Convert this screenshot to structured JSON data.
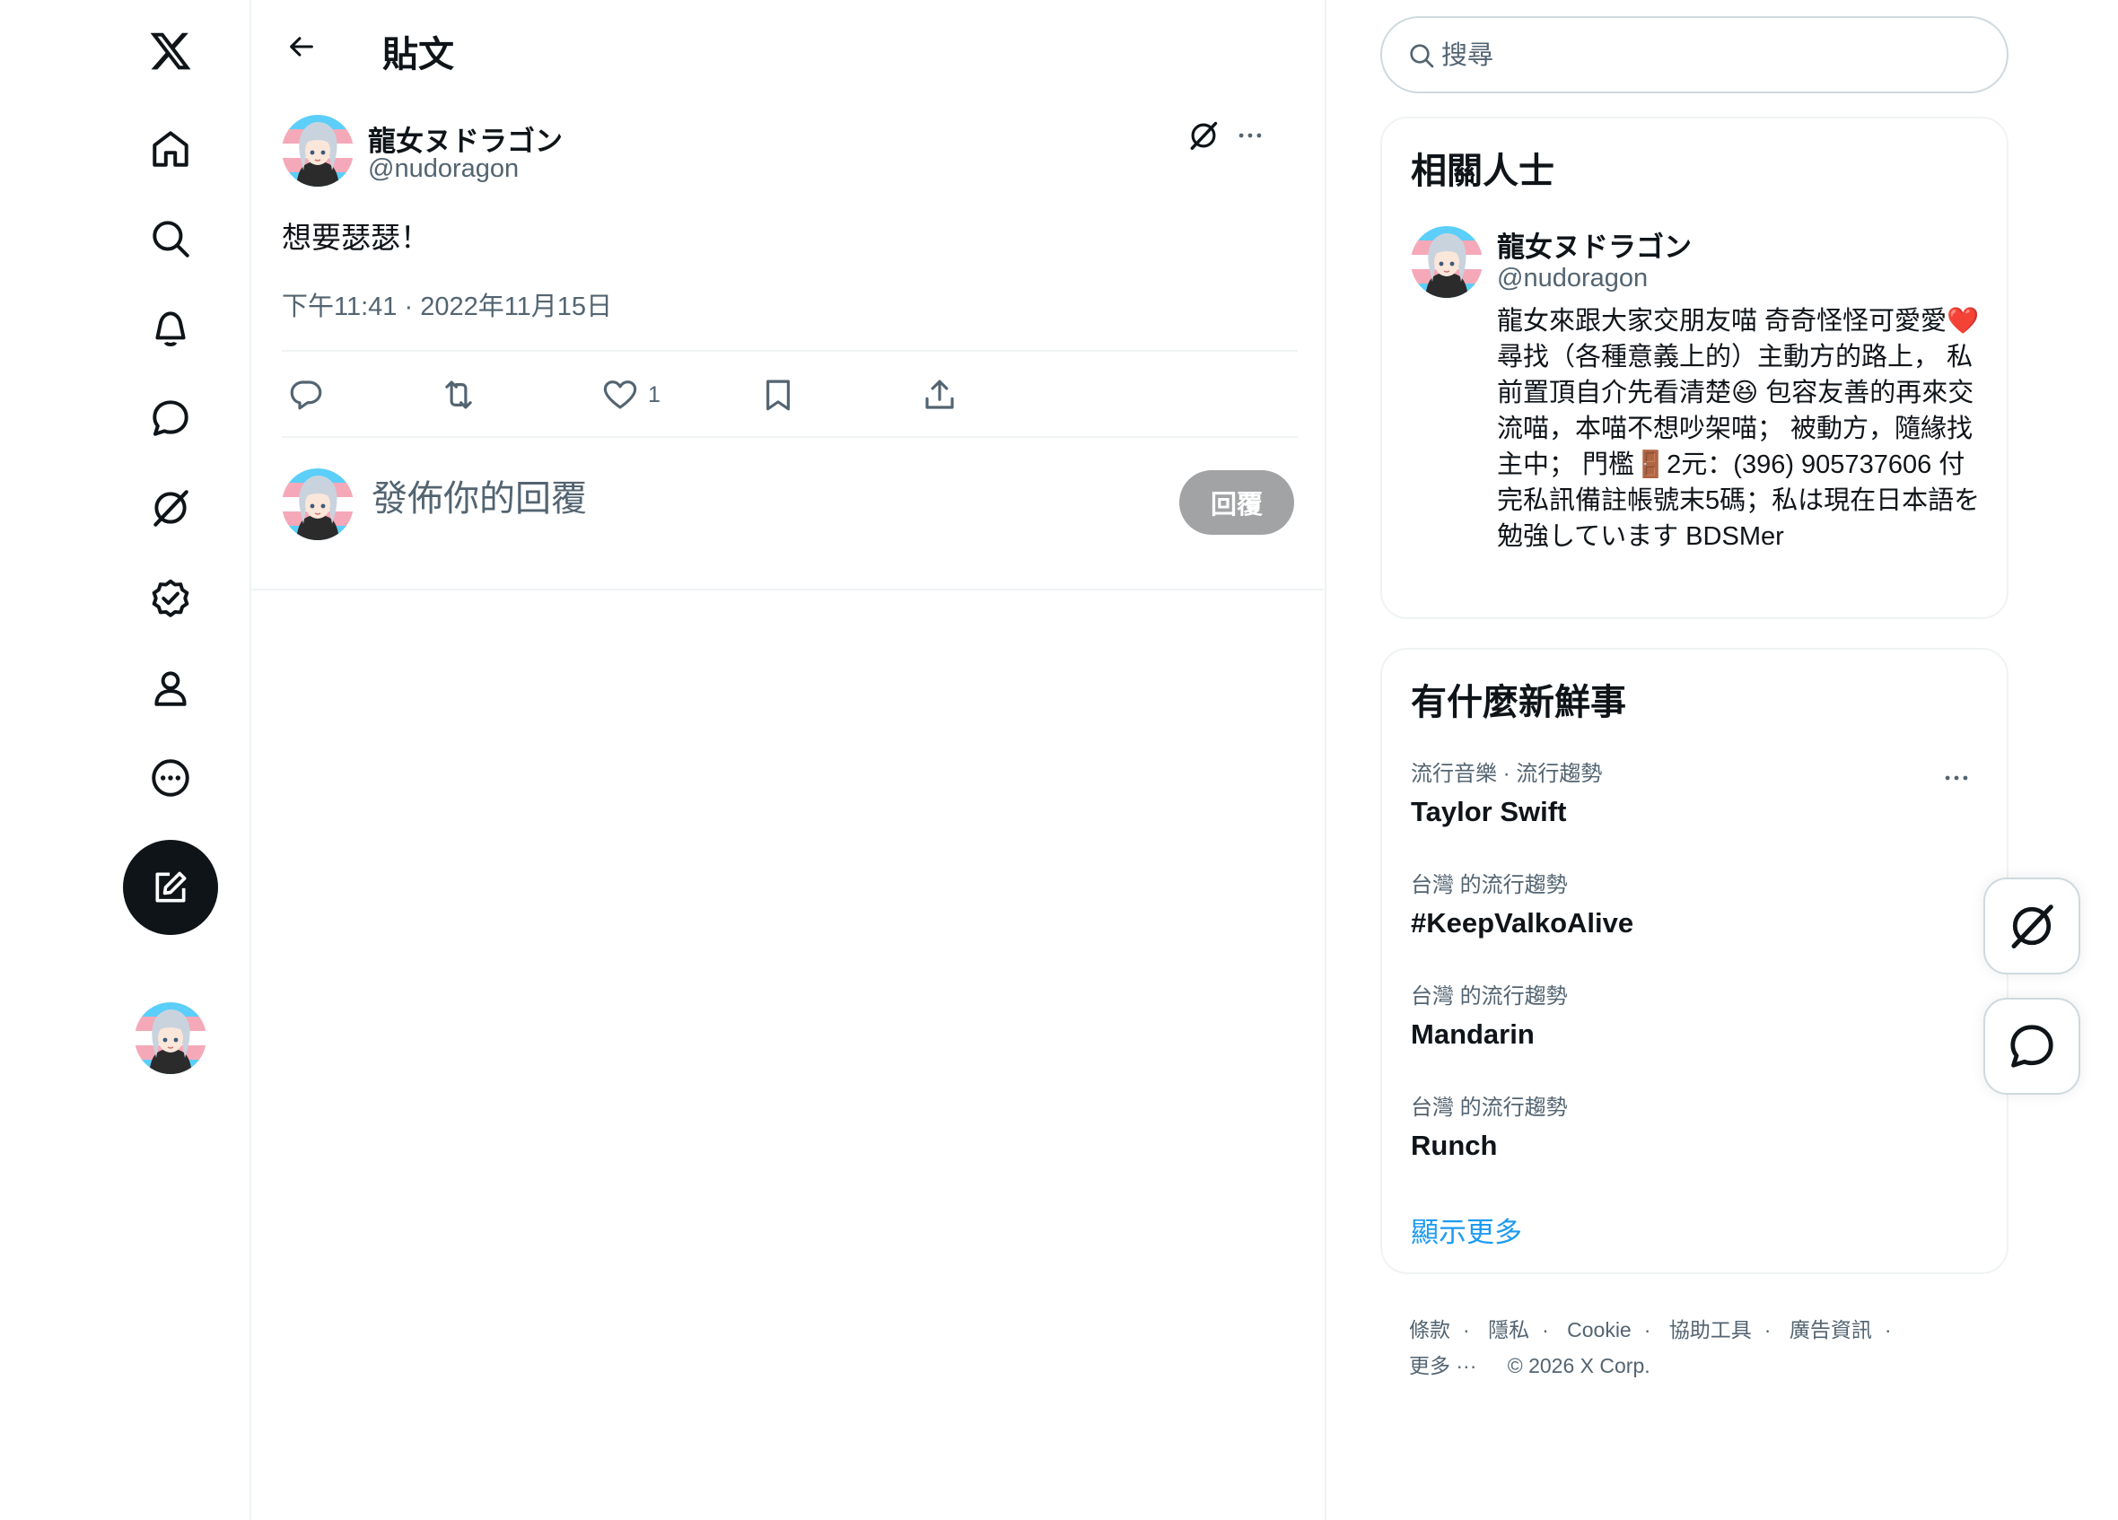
{
  "nav": {
    "items": [
      "x-logo",
      "home-icon",
      "explore-icon",
      "notifications-icon",
      "messages-icon",
      "grok-icon",
      "verified-icon",
      "profile-icon",
      "more-icon"
    ]
  },
  "header": {
    "title": "貼文"
  },
  "post": {
    "author_name": "龍女ヌドラゴン",
    "author_handle": "@nudoragon",
    "text": "想要瑟瑟！",
    "time": "下午11:41 · 2022年11月15日",
    "like_count": "1"
  },
  "reply": {
    "placeholder": "發佈你的回覆",
    "button_label": "回覆"
  },
  "search": {
    "placeholder": "搜尋"
  },
  "related": {
    "title": "相關人士",
    "name": "龍女ヌドラゴン",
    "handle": "@nudoragon",
    "bio": "龍女來跟大家交朋友喵 奇奇怪怪可愛愛❤️ 尋找（各種意義上的）主動方的路上， 私前置頂自介先看清楚😆 包容友善的再來交流喵，本喵不想吵架喵； 被動方，隨緣找主中； 門檻🚪2元：(396) 905737606 付完私訊備註帳號末5碼；私は現在日本語を勉強しています BDSMer"
  },
  "trends": {
    "title": "有什麼新鮮事",
    "items": [
      {
        "meta": "流行音樂 · 流行趨勢",
        "name": "Taylor Swift"
      },
      {
        "meta": "台灣 的流行趨勢",
        "name": "#KeepValkoAlive"
      },
      {
        "meta": "台灣 的流行趨勢",
        "name": "Mandarin"
      },
      {
        "meta": "台灣 的流行趨勢",
        "name": "Runch"
      }
    ],
    "show_more": "顯示更多"
  },
  "footer": {
    "links": [
      "條款",
      "隱私",
      "Cookie",
      "協助工具",
      "廣告資訊",
      "更多 ···"
    ],
    "copyright": "© 2026 X Corp."
  },
  "colors": {
    "accent": "#1d9bf0",
    "text": "#0f1419",
    "muted": "#536471",
    "border": "#eff3f4"
  }
}
